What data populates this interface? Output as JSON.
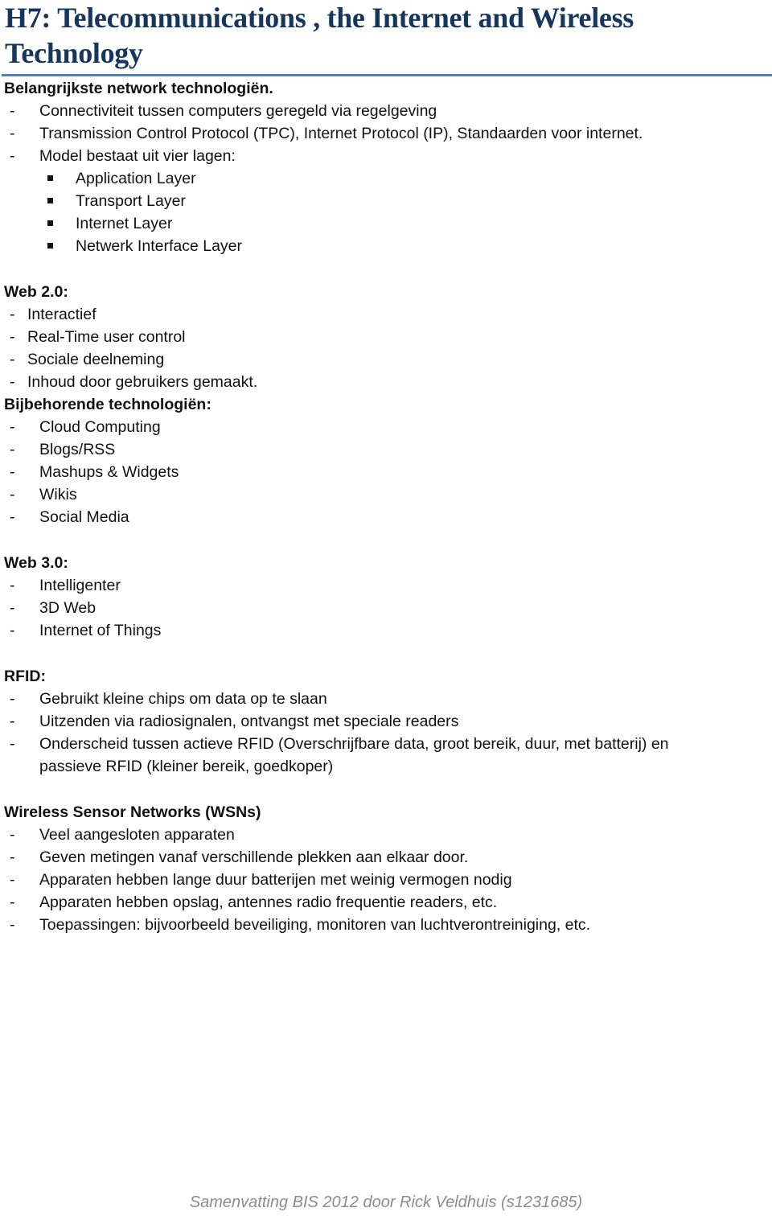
{
  "document": {
    "title": "H7: Telecommunications , the Internet and Wireless Technology",
    "bullet_dash": "-",
    "sections": {
      "network": {
        "heading": "Belangrijkste network technologiën.",
        "items": [
          "Connectiviteit tussen computers geregeld via regelgeving",
          "Transmission Control Protocol (TPC), Internet Protocol (IP), Standaarden voor internet.",
          "Model bestaat uit vier lagen:"
        ],
        "layers": [
          "Application Layer",
          "Transport Layer",
          "Internet Layer",
          "Netwerk Interface Layer"
        ]
      },
      "web2": {
        "heading": "Web 2.0:",
        "items": [
          "Interactief",
          "Real-Time user control",
          "Sociale deelneming",
          "Inhoud door gebruikers gemaakt."
        ]
      },
      "web2_tech": {
        "heading": "Bijbehorende technologiën:",
        "items": [
          "Cloud Computing",
          "Blogs/RSS",
          "Mashups & Widgets",
          "Wikis",
          "Social Media"
        ]
      },
      "web3": {
        "heading": "Web 3.0:",
        "items": [
          "Intelligenter",
          "3D Web",
          "Internet of Things"
        ]
      },
      "rfid": {
        "heading": "RFID:",
        "items": [
          "Gebruikt kleine chips om data op te slaan",
          "Uitzenden via radiosignalen, ontvangst met speciale readers",
          "Onderscheid tussen actieve RFID (Overschrijfbare data, groot bereik, duur, met batterij) en",
          "passieve RFID (kleiner bereik, goedkoper)"
        ]
      },
      "wsn": {
        "heading": "Wireless Sensor Networks (WSNs)",
        "items": [
          "Veel aangesloten apparaten",
          "Geven metingen vanaf verschillende plekken aan elkaar door.",
          "Apparaten hebben lange duur batterijen met weinig vermogen nodig",
          "Apparaten hebben opslag, antennes radio frequentie readers, etc.",
          "Toepassingen: bijvoorbeeld beveiliging, monitoren van luchtverontreiniging, etc."
        ]
      }
    },
    "footer": "Samenvatting BIS 2012 door Rick Veldhuis (s1231685)"
  }
}
